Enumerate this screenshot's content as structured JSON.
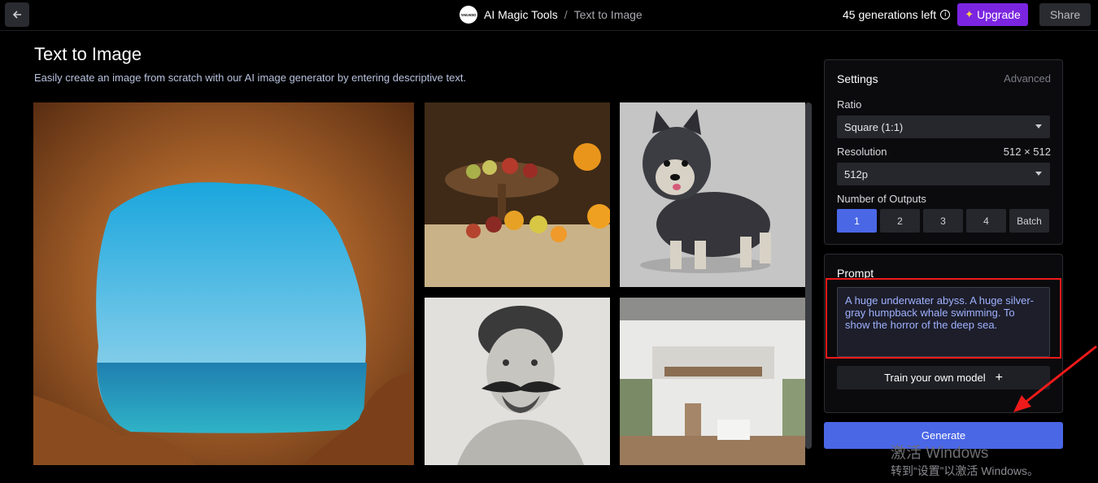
{
  "topbar": {
    "app_name": "AI Magic Tools",
    "separator": "/",
    "page_name": "Text to Image",
    "logo_text": "YAKAISO",
    "generations_left": "45 generations left",
    "upgrade_label": "Upgrade",
    "share_label": "Share"
  },
  "header": {
    "title": "Text to Image",
    "subtitle": "Easily create an image from scratch with our AI image generator by entering descriptive text."
  },
  "gallery": {
    "images": [
      {
        "name": "cave-ocean-image",
        "icon": "image"
      },
      {
        "name": "fruit-still-life-image",
        "icon": "image"
      },
      {
        "name": "husky-dog-image",
        "icon": "image"
      },
      {
        "name": "mustache-portrait-sketch-image",
        "icon": "image"
      },
      {
        "name": "modern-interior-image",
        "icon": "image"
      }
    ]
  },
  "settings": {
    "title": "Settings",
    "advanced_label": "Advanced",
    "ratio_label": "Ratio",
    "ratio_value": "Square (1:1)",
    "resolution_label": "Resolution",
    "resolution_dims": "512 × 512",
    "resolution_value": "512p",
    "outputs_label": "Number of Outputs",
    "outputs": [
      {
        "label": "1",
        "active": true
      },
      {
        "label": "2",
        "active": false
      },
      {
        "label": "3",
        "active": false
      },
      {
        "label": "4",
        "active": false
      },
      {
        "label": "Batch",
        "active": false
      }
    ]
  },
  "prompt": {
    "title": "Prompt",
    "text": "A huge underwater abyss. A huge silver-gray humpback whale swimming. To show the horror of the deep sea.",
    "train_label": "Train your own model",
    "train_icon": "+"
  },
  "generate_label": "Generate",
  "watermark": {
    "line1": "激活 Windows",
    "line2": "转到“设置”以激活 Windows。"
  },
  "colors": {
    "accent": "#4a67e6",
    "upgrade": "#7b25e0",
    "highlight": "#ef1a1a"
  }
}
